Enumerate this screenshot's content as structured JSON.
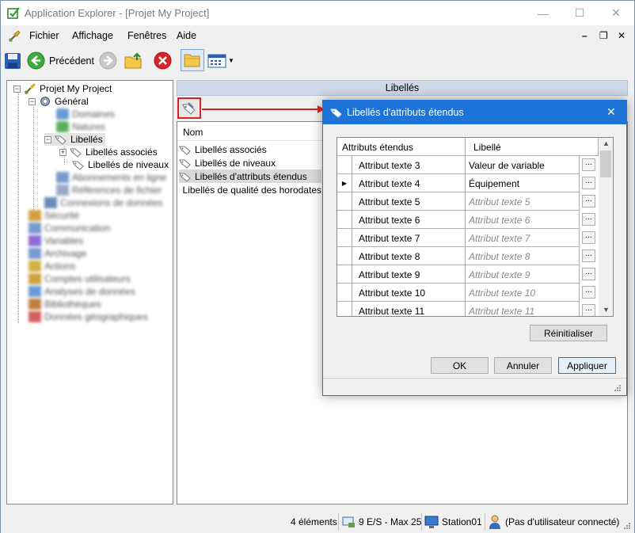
{
  "window": {
    "title": "Application Explorer - [Projet My Project]",
    "minimize": "—",
    "maximize": "☐",
    "close": "✕"
  },
  "menu": {
    "items": [
      "Fichier",
      "Affichage",
      "Fenêtres",
      "Aide"
    ],
    "mdi_min": "–",
    "mdi_restore": "❐",
    "mdi_close": "✕"
  },
  "toolbar": {
    "back_label": "Précédent"
  },
  "tree": {
    "root": "Projet My Project",
    "general": "Général",
    "blurred_general_children": [
      "Domaines",
      "Natures"
    ],
    "libelles": "Libellés",
    "libelles_children": [
      "Libellés associés",
      "Libellés de niveaux"
    ],
    "blurred_after_libelles": [
      "Abonnements en ligne",
      "Références de fichier",
      "Connexions de données"
    ],
    "blurred_top": [
      "Sécurité",
      "Communication",
      "Variables",
      "Archivage",
      "Actions",
      "Comptes utilisateurs",
      "Analyses de données",
      "Bibliothèques",
      "Données géographiques"
    ]
  },
  "panel": {
    "header": "Libellés",
    "column_name": "Nom",
    "items": [
      "Libellés associés",
      "Libellés de niveaux",
      "Libellés d'attributs étendus",
      "Libellés de qualité des horodates"
    ],
    "selected_index": 2
  },
  "dialog": {
    "title": "Libellés d'attributs étendus",
    "col_attr": "Attributs étendus",
    "col_label": "Libellé",
    "rows": [
      {
        "attr": "Attribut texte 3",
        "label": "Valeur de variable",
        "placeholder": false,
        "current": false
      },
      {
        "attr": "Attribut texte 4",
        "label": "Équipement",
        "placeholder": false,
        "current": true
      },
      {
        "attr": "Attribut texte 5",
        "label": "Attribut texte 5",
        "placeholder": true,
        "current": false
      },
      {
        "attr": "Attribut texte 6",
        "label": "Attribut texte 6",
        "placeholder": true,
        "current": false
      },
      {
        "attr": "Attribut texte 7",
        "label": "Attribut texte 7",
        "placeholder": true,
        "current": false
      },
      {
        "attr": "Attribut texte 8",
        "label": "Attribut texte 8",
        "placeholder": true,
        "current": false
      },
      {
        "attr": "Attribut texte 9",
        "label": "Attribut texte 9",
        "placeholder": true,
        "current": false
      },
      {
        "attr": "Attribut texte 10",
        "label": "Attribut texte 10",
        "placeholder": true,
        "current": false
      },
      {
        "attr": "Attribut texte 11",
        "label": "Attribut texte 11",
        "placeholder": true,
        "current": false
      }
    ],
    "ellipsis": "...",
    "reset": "Réinitialiser",
    "ok": "OK",
    "cancel": "Annuler",
    "apply": "Appliquer"
  },
  "status": {
    "elements": "4 éléments",
    "io": "9 E/S - Max 25",
    "station": "Station01",
    "user": "(Pas d'utilisateur connecté)"
  },
  "colors": {
    "dialog_titlebar": "#1e73d7",
    "annotation_arrow": "#e02020",
    "panel_header": "#cfd8e6"
  }
}
